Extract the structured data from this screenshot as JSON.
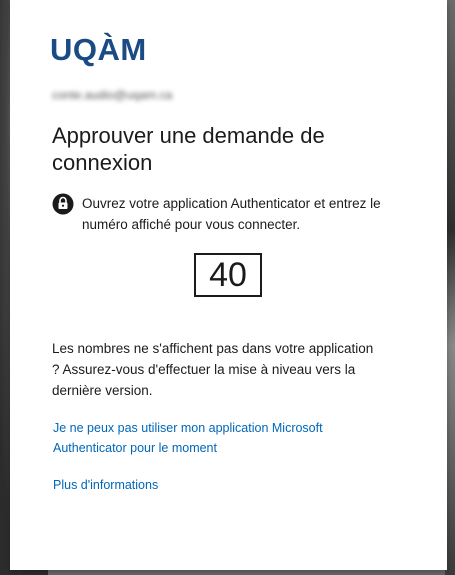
{
  "brand": {
    "logo_text": "UQÀM",
    "color": "#1a4b84"
  },
  "account": {
    "email": "conte.audio@uqam.ca"
  },
  "prompt": {
    "title": "Approuver une demande de connexion",
    "instruction": "Ouvrez votre application Authenticator et entrez le numéro affiché pour vous connecter.",
    "icon": "authenticator-lock-icon",
    "code": "40"
  },
  "notice": "Les nombres ne s'affichent pas dans votre application ? Assurez-vous d'effectuer la mise à niveau vers la dernière version.",
  "links": {
    "cannot_use": "Je ne peux pas utiliser mon application Microsoft Authenticator pour le moment",
    "more_info": "Plus d'informations",
    "color": "#0067b8"
  }
}
